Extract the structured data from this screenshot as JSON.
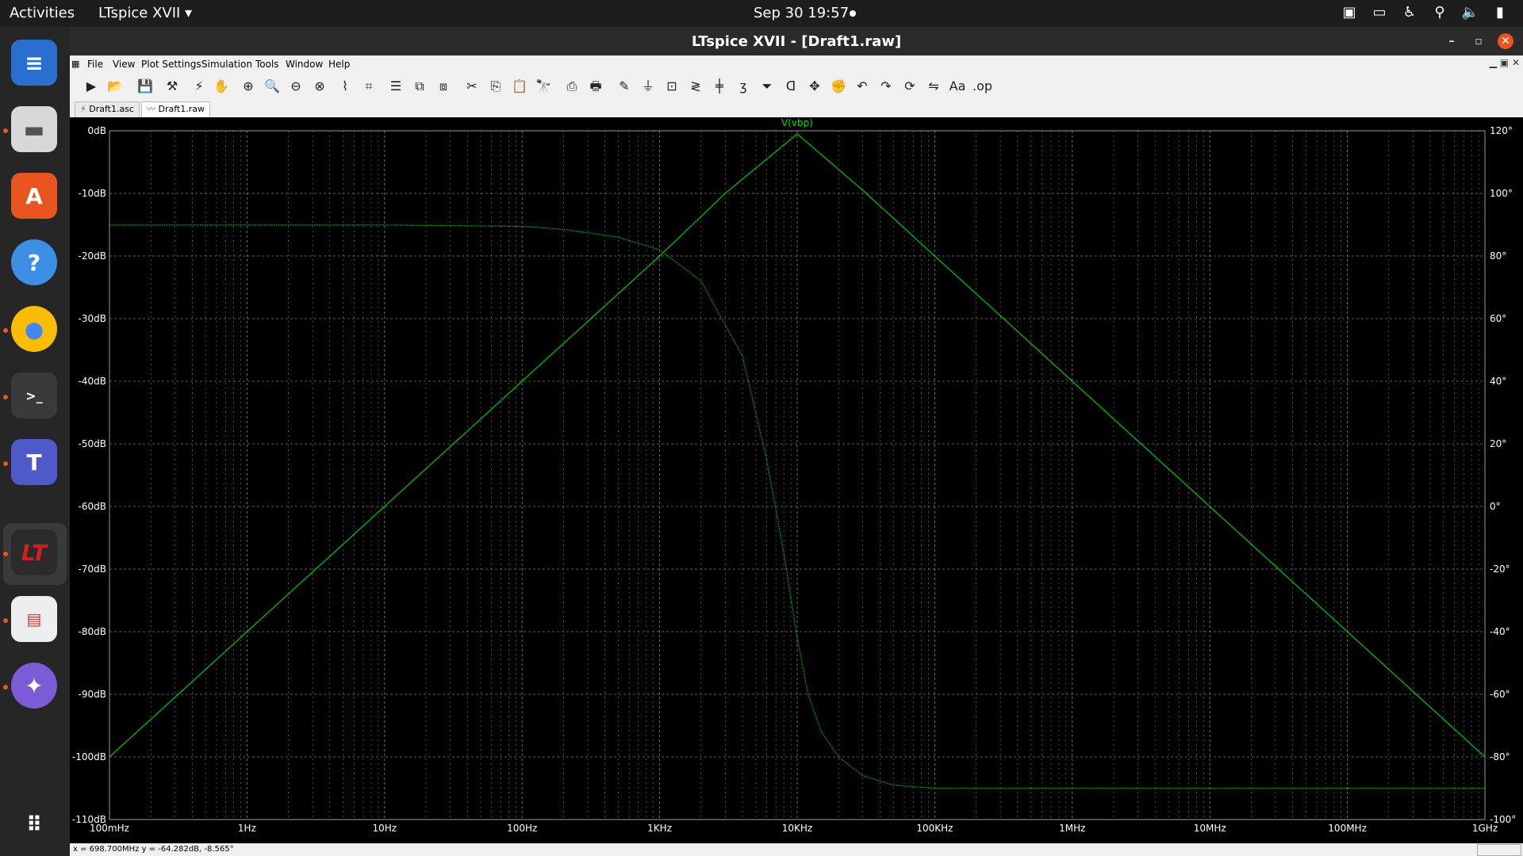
{
  "topbar": {
    "activities": "Activities",
    "app_menu": "LTspice XVII ▾",
    "clock": "Sep 30  19:57",
    "tray_icons": [
      "teams-tray-icon",
      "drive-icon",
      "accessibility-icon",
      "network-icon",
      "volume-icon",
      "battery-icon"
    ]
  },
  "dock": {
    "items": [
      "libreoffice-writer-icon",
      "files-icon",
      "software-center-icon",
      "help-icon",
      "chrome-icon",
      "terminal-icon",
      "teams-icon",
      "ltspice-icon",
      "document-viewer-icon",
      "network-app-icon",
      "show-apps-icon"
    ]
  },
  "window": {
    "title": "LTspice XVII - [Draft1.raw]"
  },
  "menu": {
    "items": [
      "File",
      "View",
      "Plot Settings",
      "Simulation",
      "Tools",
      "Window",
      "Help"
    ]
  },
  "tabs": {
    "items": [
      "Draft1.asc",
      "Draft1.raw"
    ],
    "active": 1
  },
  "status": {
    "text": "x = 698.700MHz    y = -64.282dB, -8.565°"
  },
  "colors": {
    "trace": "#00c800",
    "trace_label": "#00e000",
    "grid": "#7a7a7a",
    "axis_text": "#ffffff"
  },
  "chart_data": {
    "type": "line",
    "title": "V(vbp)",
    "x_scale": "log",
    "xlim": [
      0.1,
      1000000000
    ],
    "x_tick_values": [
      0.1,
      1,
      10,
      100,
      1000,
      10000,
      100000,
      1000000,
      10000000,
      100000000,
      1000000000
    ],
    "x_tick_labels": [
      "100mHz",
      "1Hz",
      "10Hz",
      "100Hz",
      "1KHz",
      "10KHz",
      "100KHz",
      "1MHz",
      "10MHz",
      "100MHz",
      "1GHz"
    ],
    "y_left_lim": [
      -110,
      0
    ],
    "y_left_ticks": [
      "0dB",
      "-10dB",
      "-20dB",
      "-30dB",
      "-40dB",
      "-50dB",
      "-60dB",
      "-70dB",
      "-80dB",
      "-90dB",
      "-100dB",
      "-110dB"
    ],
    "y_right_lim": [
      -100,
      120
    ],
    "y_right_ticks": [
      "120°",
      "100°",
      "80°",
      "60°",
      "40°",
      "20°",
      "0°",
      "-20°",
      "-40°",
      "-60°",
      "-80°",
      "-100°"
    ],
    "grid": true,
    "series": [
      {
        "name": "V(vbp)",
        "axis": "left",
        "style": "solid",
        "x": [
          0.1,
          1,
          10,
          100,
          1000,
          3000,
          10000,
          30000,
          100000,
          1000000,
          10000000,
          100000000,
          1000000000
        ],
        "y": [
          -100,
          -80,
          -60,
          -40,
          -20,
          -10,
          -0.5,
          -9.5,
          -20,
          -40,
          -60,
          -80,
          -100
        ]
      },
      {
        "name": "phase",
        "axis": "right",
        "style": "dotted",
        "x": [
          0.1,
          10,
          100,
          200,
          500,
          1000,
          2000,
          4000,
          6000,
          8000,
          10000,
          12000,
          15000,
          20000,
          30000,
          50000,
          100000,
          1000000,
          1000000000
        ],
        "y": [
          89.9,
          89.9,
          89.5,
          88.5,
          86,
          82,
          72,
          48,
          15,
          -15,
          -42,
          -60,
          -72,
          -80,
          -86,
          -89,
          -90,
          -90,
          -90
        ]
      }
    ]
  }
}
